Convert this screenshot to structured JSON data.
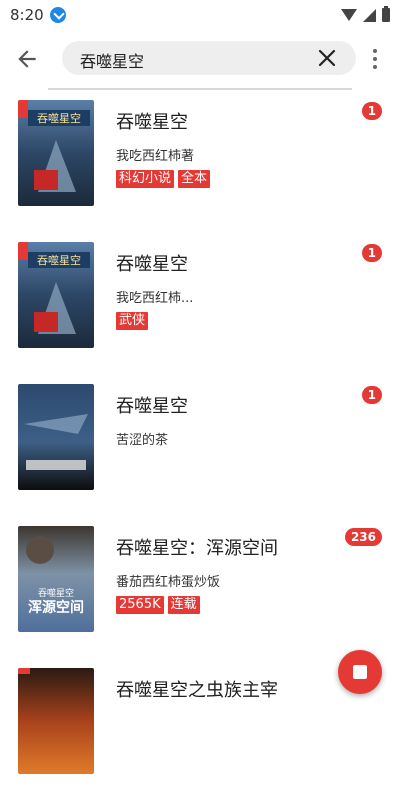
{
  "status_bar": {
    "time": "8:20"
  },
  "search": {
    "query": "吞噬星空"
  },
  "results": [
    {
      "title": "吞噬星空",
      "author": "我吃西红柿著",
      "tags": [
        "科幻小说",
        "全本"
      ],
      "count": "1"
    },
    {
      "title": "吞噬星空",
      "author": "我吃西红柿...",
      "tags": [
        "武侠"
      ],
      "count": "1"
    },
    {
      "title": "吞噬星空",
      "author": "苦涩的茶",
      "tags": [],
      "count": "1"
    },
    {
      "title": "吞噬星空：浑源空间",
      "author": "番茄西红柿蛋炒饭",
      "tags": [
        "2565K",
        "连载"
      ],
      "count": "236"
    },
    {
      "title": "吞噬星空之虫族主宰",
      "author": "",
      "tags": [],
      "count": ""
    }
  ],
  "covers": {
    "book1": {
      "brand_text": "吞噬星空"
    },
    "book4": {
      "brand_text": "浑源空间",
      "subtitle_text": "吞噬星空"
    }
  },
  "colors": {
    "accent": "#e53935",
    "search_bg": "#eeeeee"
  },
  "icons": {
    "back": "arrow-left",
    "clear": "close",
    "more": "more-vert",
    "stop": "stop"
  }
}
